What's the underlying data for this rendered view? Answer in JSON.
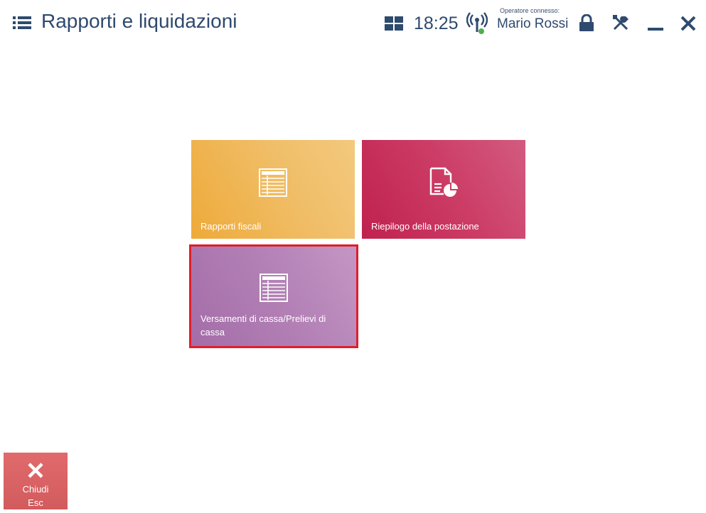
{
  "header": {
    "title": "Rapporti e liquidazioni",
    "time": "18:25",
    "operator_caption": "Operatore connesso:",
    "operator_name": "Mario Rossi",
    "icons": [
      "list-menu-icon",
      "tiles-view-icon",
      "signal-icon",
      "lock-icon",
      "tools-icon",
      "minimize-icon",
      "close-icon"
    ]
  },
  "tiles": [
    {
      "label": "Rapporti fiscali",
      "icon": "table-icon",
      "color": "#eeaa3a",
      "selected": false
    },
    {
      "label": "Riepilogo della postazione",
      "icon": "document-chart-icon",
      "color": "#c0214f",
      "selected": false
    },
    {
      "label": "Versamenti di cassa/Prelievi di cassa",
      "icon": "table-icon",
      "color": "#a46da8",
      "selected": true
    }
  ],
  "footer": {
    "close_label": "Chiudi",
    "close_shortcut": "Esc",
    "close_color": "#d25b5d"
  },
  "colors": {
    "text": "#2e4a6e",
    "selection_border": "#e01e2a",
    "status_online": "#4caf50"
  }
}
